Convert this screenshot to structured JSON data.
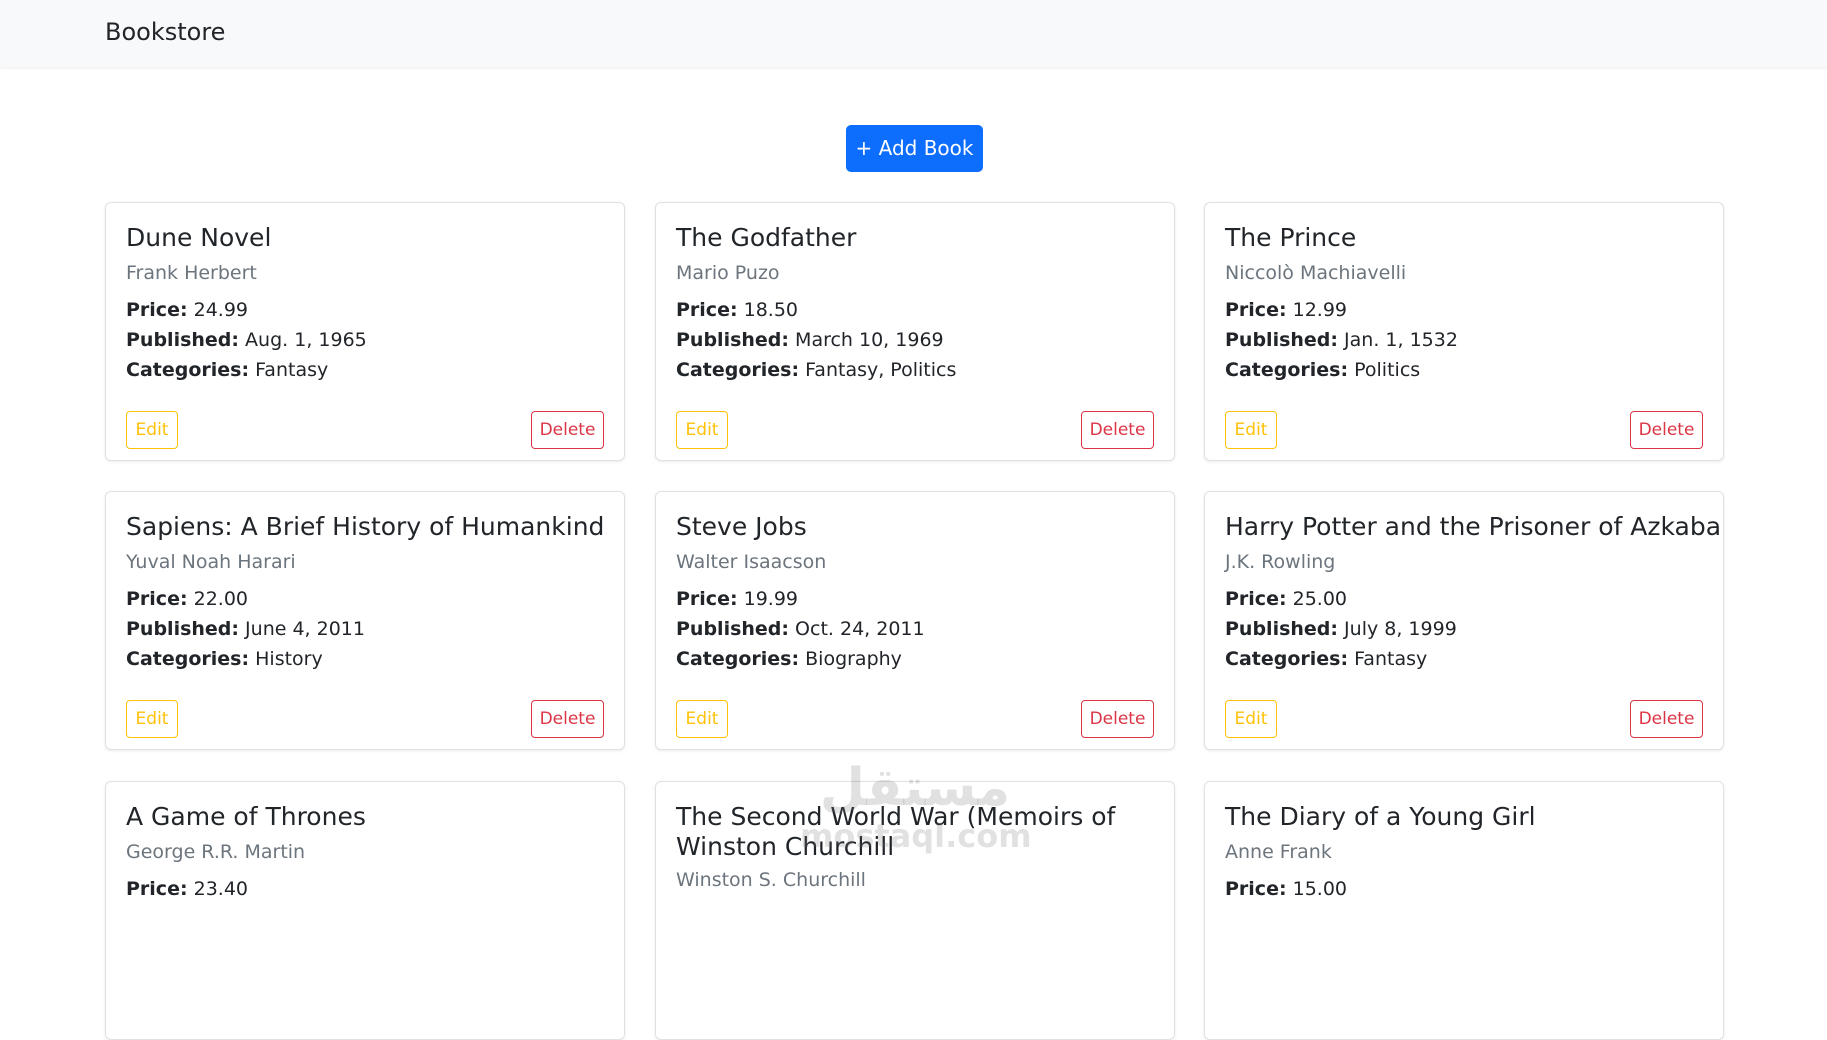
{
  "navbar": {
    "brand": "Bookstore"
  },
  "actions": {
    "add_book_label": "+ Add Book"
  },
  "labels": {
    "price": "Price:",
    "published": "Published:",
    "categories": "Categories:",
    "edit": "Edit",
    "delete": "Delete"
  },
  "books": [
    {
      "title": "Dune Novel",
      "author": "Frank Herbert",
      "price": "24.99",
      "published": "Aug. 1, 1965",
      "categories": "Fantasy"
    },
    {
      "title": "The Godfather",
      "author": "Mario Puzo",
      "price": "18.50",
      "published": "March 10, 1969",
      "categories": "Fantasy, Politics"
    },
    {
      "title": "The Prince",
      "author": "Niccolò Machiavelli",
      "price": "12.99",
      "published": "Jan. 1, 1532",
      "categories": "Politics"
    },
    {
      "title": "Sapiens: A Brief History of Humankind",
      "author": "Yuval Noah Harari",
      "price": "22.00",
      "published": "June 4, 2011",
      "categories": "History"
    },
    {
      "title": "Steve Jobs",
      "author": "Walter Isaacson",
      "price": "19.99",
      "published": "Oct. 24, 2011",
      "categories": "Biography"
    },
    {
      "title": "Harry Potter and the Prisoner of Azkaban",
      "author": "J.K. Rowling",
      "price": "25.00",
      "published": "July 8, 1999",
      "categories": "Fantasy"
    },
    {
      "title": "A Game of Thrones",
      "author": "George R.R. Martin",
      "price": "23.40"
    },
    {
      "title": "The Second World War (Memoirs of Winston Churchill",
      "author": "Winston S. Churchill"
    },
    {
      "title": "The Diary of a Young Girl",
      "author": "Anne Frank",
      "price": "15.00"
    }
  ],
  "watermark": {
    "arabic": "مستقل",
    "latin": "mostaql.com"
  }
}
